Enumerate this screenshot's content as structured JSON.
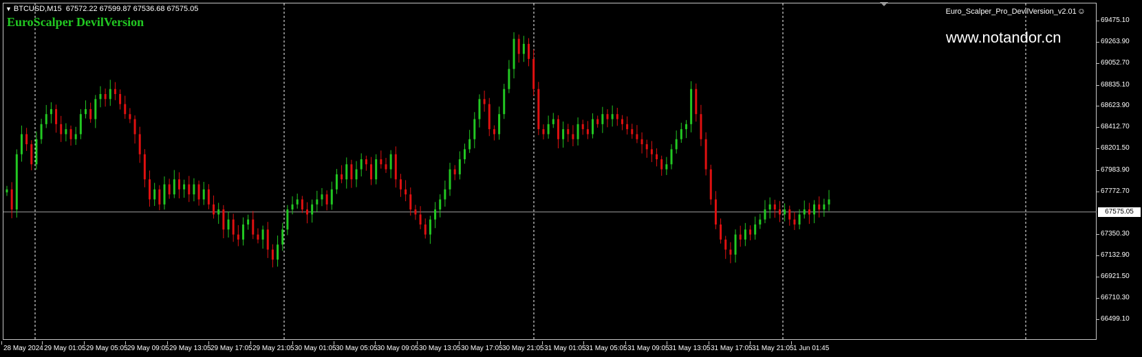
{
  "header": {
    "symbol": "BTCUSD,M15",
    "ohlc": "67572.22 67599.87 67536.68 67575.05",
    "indicator_title": "EuroScalper DevilVersion",
    "watermark": "www.notandor.cn",
    "ea_name": "Euro_Scalper_Pro_DevilVersion_v2.01",
    "smile_glyph": "☺"
  },
  "colors": {
    "bull": "#22c822",
    "bear": "#e01010",
    "background": "#000000",
    "grid": "#ffffff"
  },
  "price_axis": {
    "ticks": [
      "69475.10",
      "69263.90",
      "69052.70",
      "68835.10",
      "68623.90",
      "68412.70",
      "68201.50",
      "67983.90",
      "67772.70",
      "67575.05",
      "67350.30",
      "67132.90",
      "66921.50",
      "66710.30",
      "66499.10"
    ],
    "current_price": "67575.05"
  },
  "time_axis": {
    "labels": [
      "28 May 2024",
      "29 May 01:05",
      "29 May 05:05",
      "29 May 09:05",
      "29 May 13:05",
      "29 May 17:05",
      "29 May 21:05",
      "30 May 01:05",
      "30 May 05:05",
      "30 May 09:05",
      "30 May 13:05",
      "30 May 17:05",
      "30 May 21:05",
      "31 May 01:05",
      "31 May 05:05",
      "31 May 09:05",
      "31 May 13:05",
      "31 May 17:05",
      "31 May 21:05",
      "1 Jun 01:45"
    ]
  },
  "chart_data": {
    "type": "candlestick",
    "ylim": [
      66499.1,
      69475.1
    ],
    "closes": [
      67800,
      67600,
      68150,
      68350,
      68250,
      68050,
      68300,
      68450,
      68550,
      68600,
      68450,
      68350,
      68400,
      68300,
      68350,
      68550,
      68600,
      68500,
      68700,
      68750,
      68700,
      68800,
      68750,
      68650,
      68550,
      68500,
      68350,
      68150,
      67900,
      67700,
      67800,
      67650,
      67850,
      67750,
      67900,
      67800,
      67850,
      67750,
      67850,
      67700,
      67800,
      67650,
      67550,
      67600,
      67400,
      67500,
      67350,
      67300,
      67450,
      67500,
      67350,
      67300,
      67400,
      67200,
      67100,
      67250,
      67400,
      67600,
      67650,
      67700,
      67600,
      67550,
      67650,
      67700,
      67750,
      67650,
      67800,
      67950,
      67900,
      68050,
      67900,
      68000,
      68100,
      68050,
      67900,
      68100,
      68050,
      68000,
      68150,
      67900,
      67800,
      67750,
      67600,
      67550,
      67450,
      67350,
      67500,
      67600,
      67700,
      67800,
      68000,
      67950,
      68100,
      68200,
      68300,
      68500,
      68700,
      68650,
      68400,
      68350,
      68550,
      68800,
      69000,
      69300,
      69150,
      69250,
      69100,
      68800,
      68400,
      68350,
      68450,
      68500,
      68300,
      68400,
      68350,
      68300,
      68450,
      68400,
      68350,
      68500,
      68450,
      68550,
      68500,
      68550,
      68500,
      68450,
      68400,
      68350,
      68300,
      68250,
      68200,
      68150,
      68100,
      68000,
      68050,
      68200,
      68300,
      68400,
      68450,
      68800,
      68550,
      68300,
      68000,
      67700,
      67450,
      67300,
      67200,
      67150,
      67350,
      67300,
      67400,
      67350,
      67450,
      67500,
      67600,
      67650,
      67600,
      67550,
      67600,
      67500,
      67450,
      67550,
      67600,
      67550,
      67650,
      67600,
      67650,
      67700
    ]
  }
}
